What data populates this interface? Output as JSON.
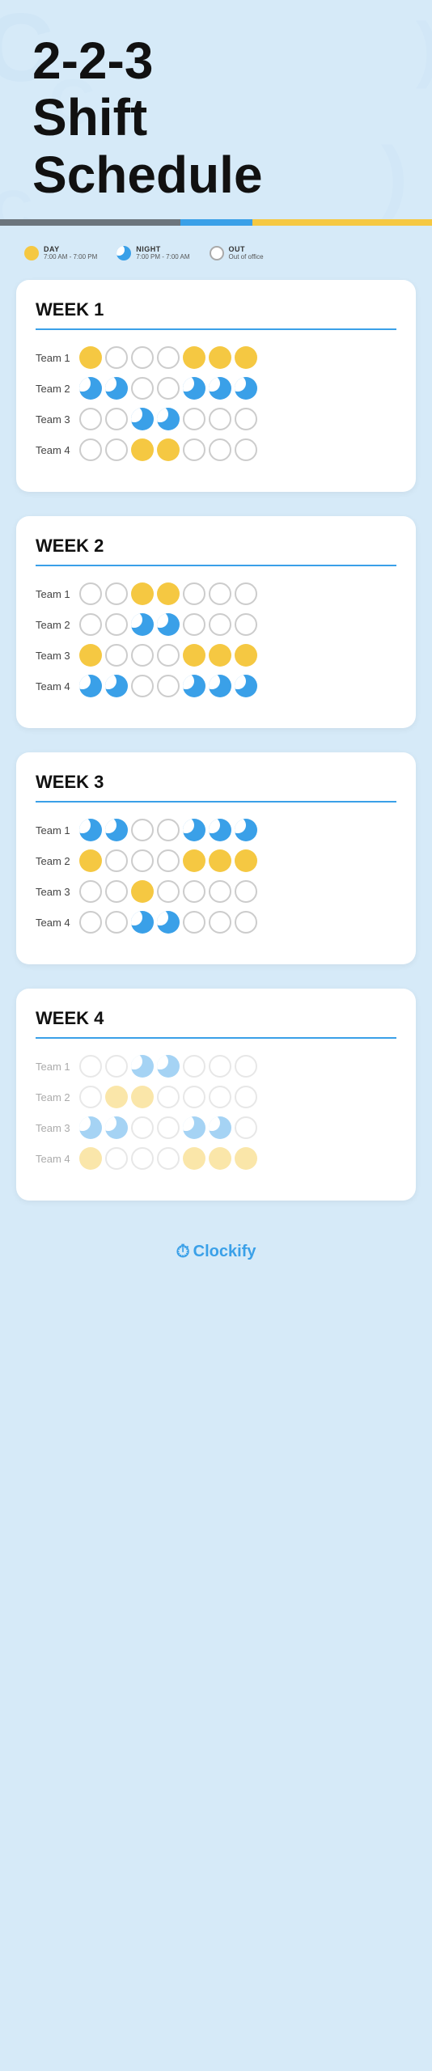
{
  "header": {
    "title_line1": "2-2-3",
    "title_line2": "Shift",
    "title_line3": "Schedule"
  },
  "legend": {
    "day_label": "DAY",
    "day_time": "7:00 AM - 7:00 PM",
    "night_label": "NIGHT",
    "night_time": "7:00 PM - 7:00 AM",
    "out_label": "OUT",
    "out_desc": "Out of office"
  },
  "weeks": [
    {
      "label": "WEEK 1",
      "teams": [
        {
          "name": "Team 1",
          "shifts": [
            "day",
            "off",
            "off",
            "off",
            "day",
            "day",
            "day"
          ]
        },
        {
          "name": "Team 2",
          "shifts": [
            "night",
            "night",
            "off",
            "off",
            "night",
            "night",
            "night"
          ]
        },
        {
          "name": "Team 3",
          "shifts": [
            "off",
            "off",
            "night",
            "night",
            "off",
            "off",
            "off"
          ]
        },
        {
          "name": "Team 4",
          "shifts": [
            "off",
            "off",
            "day",
            "day",
            "off",
            "off",
            "off"
          ]
        }
      ]
    },
    {
      "label": "WEEK 2",
      "teams": [
        {
          "name": "Team 1",
          "shifts": [
            "off",
            "off",
            "day",
            "day",
            "off",
            "off",
            "off"
          ]
        },
        {
          "name": "Team 2",
          "shifts": [
            "off",
            "off",
            "night",
            "night",
            "off",
            "off",
            "off"
          ]
        },
        {
          "name": "Team 3",
          "shifts": [
            "day",
            "off",
            "off",
            "off",
            "day",
            "day",
            "day"
          ]
        },
        {
          "name": "Team 4",
          "shifts": [
            "night",
            "night",
            "off",
            "off",
            "night",
            "night",
            "night"
          ]
        }
      ]
    },
    {
      "label": "WEEK 3",
      "teams": [
        {
          "name": "Team 1",
          "shifts": [
            "night",
            "night",
            "off",
            "off",
            "night",
            "night",
            "night"
          ]
        },
        {
          "name": "Team 2",
          "shifts": [
            "day",
            "off",
            "off",
            "off",
            "day",
            "day",
            "day"
          ]
        },
        {
          "name": "Team 3",
          "shifts": [
            "off",
            "off",
            "day",
            "off",
            "off",
            "off",
            "off"
          ]
        },
        {
          "name": "Team 4",
          "shifts": [
            "off",
            "off",
            "night",
            "night",
            "off",
            "off",
            "off"
          ]
        }
      ]
    },
    {
      "label": "WEEK 4",
      "teams": [
        {
          "name": "Team 1",
          "shifts": [
            "off",
            "off",
            "night",
            "night",
            "off",
            "off",
            "off"
          ],
          "faded": true
        },
        {
          "name": "Team 2",
          "shifts": [
            "off",
            "day",
            "day",
            "off",
            "off",
            "off",
            "off"
          ],
          "faded": true
        },
        {
          "name": "Team 3",
          "shifts": [
            "night",
            "night",
            "off",
            "off",
            "night",
            "night",
            "off"
          ],
          "faded": true
        },
        {
          "name": "Team 4",
          "shifts": [
            "day",
            "off",
            "off",
            "off",
            "day",
            "day",
            "day"
          ],
          "faded": true
        }
      ]
    }
  ],
  "footer": {
    "logo_text": "Clockify"
  }
}
